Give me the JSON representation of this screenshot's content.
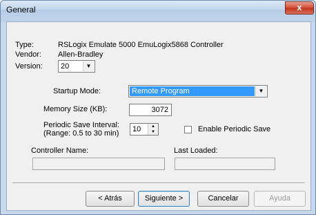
{
  "window": {
    "title": "General",
    "close_label": "x"
  },
  "info": {
    "type_label": "Type:",
    "type_value": "RSLogix Emulate 5000  EmuLogix5868 Controller",
    "vendor_label": "Vendor:",
    "vendor_value": "Allen-Bradley",
    "version_label": "Version:",
    "version_value": "20"
  },
  "startup": {
    "label": "Startup Mode:",
    "value": "Remote Program"
  },
  "memory": {
    "label": "Memory Size (KB):",
    "value": "3072"
  },
  "periodic": {
    "label_line1": "Periodic Save Interval:",
    "label_line2": "(Range: 0.5 to 30 min)",
    "value": "10",
    "enable_label": "Enable Periodic Save",
    "enabled": false
  },
  "controller_name": {
    "label": "Controller Name:",
    "value": ""
  },
  "last_loaded": {
    "label": "Last Loaded:",
    "value": ""
  },
  "buttons": {
    "back": "< Atrás",
    "next": "Siguiente >",
    "cancel": "Cancelar",
    "help": "Ayuda"
  }
}
